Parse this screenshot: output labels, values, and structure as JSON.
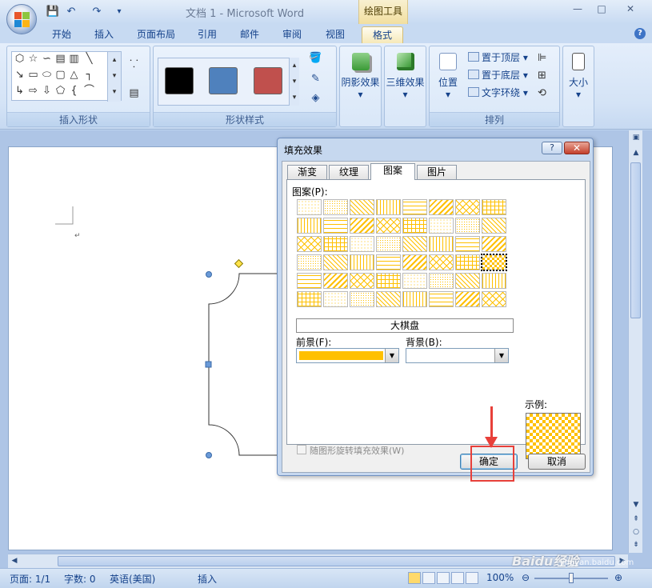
{
  "window": {
    "title": "文档 1 - Microsoft Word",
    "context_tab_title": "绘图工具",
    "minimize": "—",
    "maximize": "□",
    "close": "✕"
  },
  "quick_access": {
    "save": "💾",
    "undo": "↶",
    "redo": "↷",
    "customize": "▾"
  },
  "tabs": [
    "开始",
    "插入",
    "页面布局",
    "引用",
    "邮件",
    "审阅",
    "视图",
    "格式"
  ],
  "ribbon": {
    "groups": {
      "insert_shapes": "插入形状",
      "shape_styles": "形状样式",
      "arrange": "排列"
    },
    "shape_style_colors": [
      "#000000",
      "#4f81bd",
      "#c0504d"
    ],
    "shadow_effects": "阴影效果",
    "threed_effects": "三维效果",
    "position": "位置",
    "bring_to_front": "置于顶层",
    "send_to_back": "置于底层",
    "text_wrapping": "文字环绕",
    "size": "大小"
  },
  "dialog": {
    "title": "填充效果",
    "help": "?",
    "close": "✕",
    "tabs": [
      "渐变",
      "纹理",
      "图案",
      "图片"
    ],
    "active_tab": "图案",
    "pattern_label": "图案(P):",
    "selected_pattern_name": "大棋盘",
    "foreground_label": "前景(F):",
    "background_label": "背景(B):",
    "foreground_color": "#ffc000",
    "background_color": "#ffffff",
    "sample_label": "示例:",
    "rotate_with_shape_label": "随图形旋转填充效果(W)",
    "ok": "确定",
    "cancel": "取消"
  },
  "status": {
    "page": "页面: 1/1",
    "words": "字数: 0",
    "language": "英语(美国)",
    "mode": "插入",
    "zoom": "100%"
  },
  "watermark": {
    "brand": "Baidu经验",
    "url": "jingyan.baidu.com"
  }
}
